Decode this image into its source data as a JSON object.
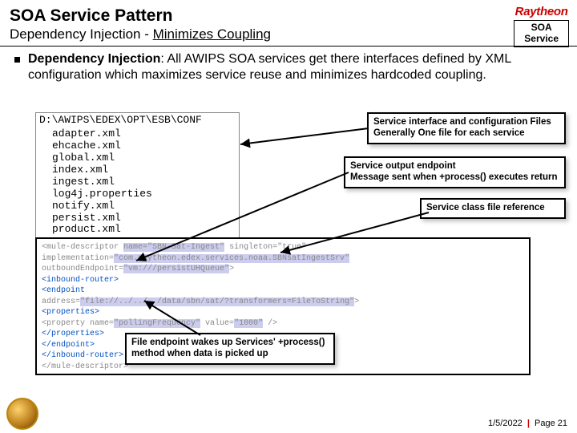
{
  "header": {
    "title": "SOA Service Pattern",
    "subtitle_plain": "Dependency Injection - ",
    "subtitle_underlined": "Minimizes  Coupling"
  },
  "brand": "Raytheon",
  "tag": {
    "l1": "SOA",
    "l2": "Service"
  },
  "bullet": {
    "term": "Dependency Injection",
    "colon": ":   ",
    "text": "All AWIPS SOA services get there interfaces defined by XML configuration which maximizes service reuse and minimizes hardcoded coupling."
  },
  "filelist": {
    "path": "D:\\AWIPS\\EDEX\\OPT\\ESB\\CONF",
    "files": [
      "adapter.xml",
      "ehcache.xml",
      "global.xml",
      "index.xml",
      "ingest.xml",
      "log4j.properties",
      "notify.xml",
      "persist.xml",
      "product.xml"
    ]
  },
  "callouts": {
    "c1a": "Service interface and configuration Files",
    "c1b": "Generally One file for each service",
    "c2a": "Service output endpoint",
    "c2b": "Message sent when +process() executes return",
    "c3": "Service class file reference",
    "c4a": "File endpoint wakes up Services' +process()",
    "c4b": "method when data is picked up"
  },
  "xml": {
    "l1a": "<mule-descriptor ",
    "l1b": "name=\"SBN-Sat-Ingest\"",
    "l1c": " singleton=\"true\"",
    "l2a": "    implementation=",
    "l2b": "\"com.raytheon.edex.services.noaa.SBNsatIngestSrv\"",
    "l3a": "    outboundEndpoint=",
    "l3b": "\"vm:///persistUHQueue\"",
    "l3c": ">",
    "l4": "  <inbound-router>",
    "l5": "      <endpoint",
    "l6a": "          address=",
    "l6b": "\"file://../../../data/sbn/sat/?transformers=FileToString\"",
    "l6c": ">",
    "l7": "          <properties>",
    "l8a": "              <property name=",
    "l8b": "\"pollingFrequency\"",
    "l8c": " value=",
    "l8d": "\"1000\"",
    "l8e": " />",
    "l9": "          </properties>",
    "l10": "      </endpoint>",
    "l11": "  </inbound-router>",
    "l12": "</mule-descriptor>"
  },
  "footer": {
    "date": "1/5/2022",
    "page": "Page 21"
  }
}
